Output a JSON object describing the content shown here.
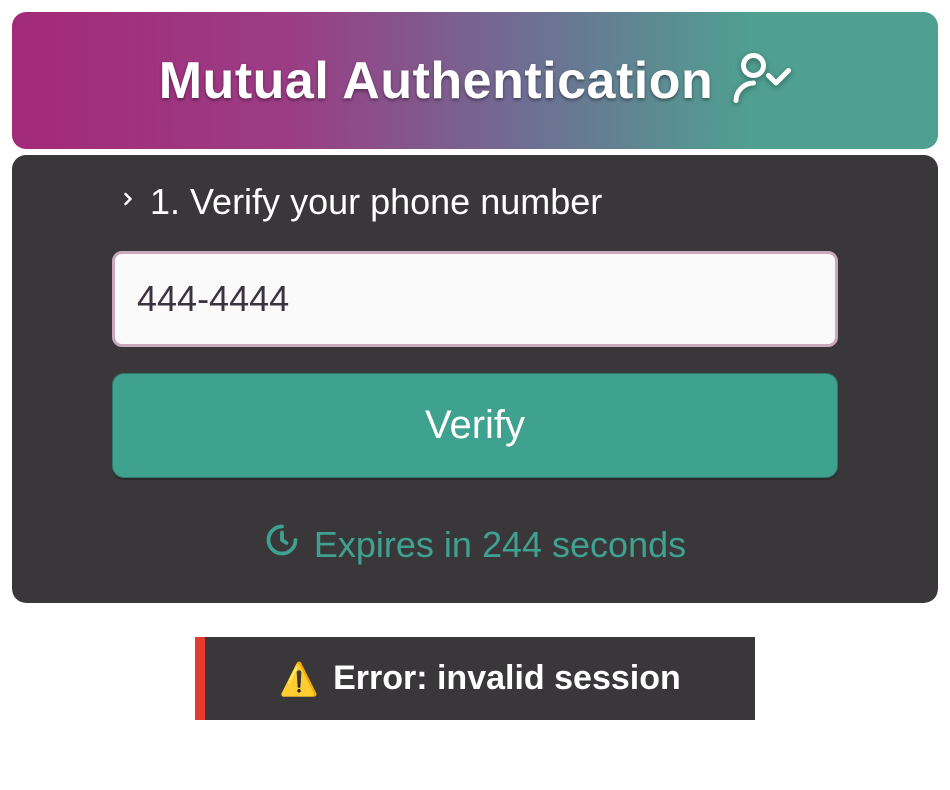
{
  "header": {
    "title": "Mutual Authentication"
  },
  "step": {
    "label": "1. Verify your phone number"
  },
  "phone": {
    "value": "444-4444"
  },
  "verify": {
    "label": "Verify"
  },
  "expires": {
    "text": "Expires in 244 seconds",
    "seconds": 244
  },
  "error": {
    "text": "Error: invalid session"
  },
  "colors": {
    "accent_teal": "#3fa28f",
    "accent_magenta": "#a3297a",
    "panel_bg": "#39373a",
    "error_red": "#e43b2f"
  }
}
